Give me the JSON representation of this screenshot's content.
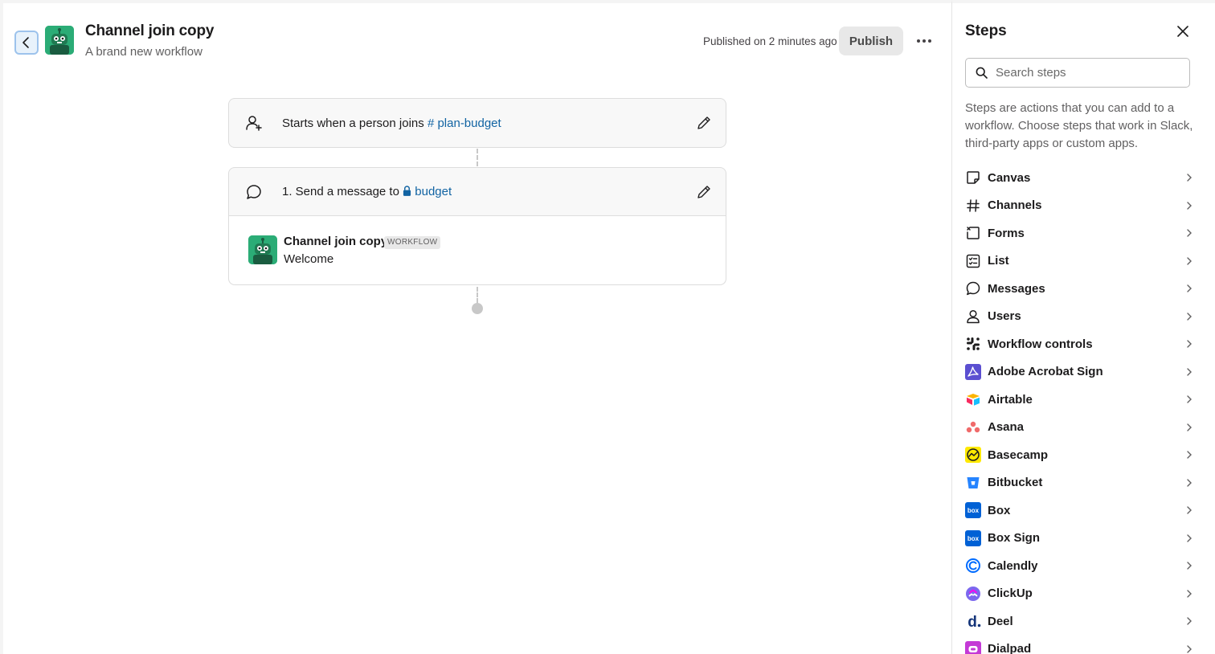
{
  "header": {
    "title": "Channel join copy",
    "subtitle": "A brand new workflow",
    "published_status": "Published on 2 minutes ago",
    "publish_label": "Publish"
  },
  "trigger": {
    "prefix": "Starts when a person joins",
    "channel": "plan-budget",
    "channel_symbol": "#"
  },
  "step1": {
    "prefix": "1. Send a message to",
    "channel": "budget",
    "sender_name": "Channel join copy",
    "sender_badge": "WORKFLOW",
    "message": "Welcome"
  },
  "panel": {
    "title": "Steps",
    "search_placeholder": "Search steps",
    "description": "Steps are actions that you can add to a workflow. Choose steps that work in Slack, third-party apps or custom apps.",
    "items": [
      {
        "label": "Canvas",
        "icon": "canvas-icon"
      },
      {
        "label": "Channels",
        "icon": "hash-icon"
      },
      {
        "label": "Forms",
        "icon": "forms-icon"
      },
      {
        "label": "List",
        "icon": "list-icon"
      },
      {
        "label": "Messages",
        "icon": "message-bubble-icon"
      },
      {
        "label": "Users",
        "icon": "user-icon"
      },
      {
        "label": "Workflow controls",
        "icon": "workflow-controls-icon"
      },
      {
        "label": "Adobe Acrobat Sign",
        "icon": "adobe-acrobat-sign-icon"
      },
      {
        "label": "Airtable",
        "icon": "airtable-icon"
      },
      {
        "label": "Asana",
        "icon": "asana-icon"
      },
      {
        "label": "Basecamp",
        "icon": "basecamp-icon"
      },
      {
        "label": "Bitbucket",
        "icon": "bitbucket-icon"
      },
      {
        "label": "Box",
        "icon": "box-icon"
      },
      {
        "label": "Box Sign",
        "icon": "box-sign-icon"
      },
      {
        "label": "Calendly",
        "icon": "calendly-icon"
      },
      {
        "label": "ClickUp",
        "icon": "clickup-icon"
      },
      {
        "label": "Deel",
        "icon": "deel-icon"
      },
      {
        "label": "Dialpad",
        "icon": "dialpad-icon"
      }
    ]
  },
  "colors": {
    "link": "#1264a3",
    "bot_green": "#2bac76",
    "publish_bg": "#e8e8e8"
  }
}
